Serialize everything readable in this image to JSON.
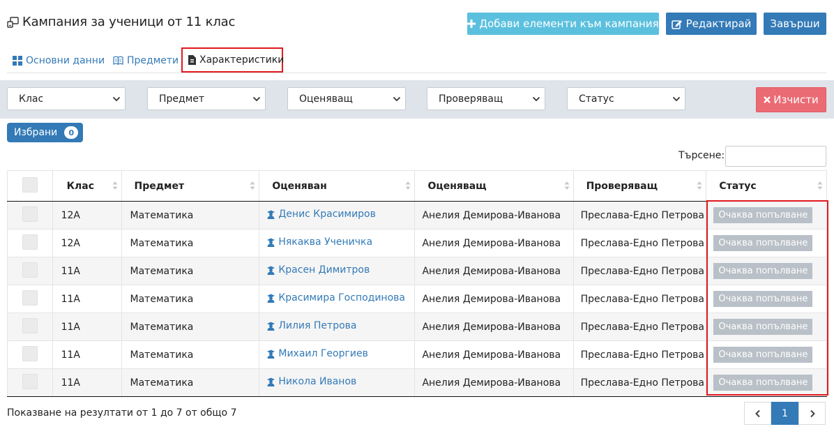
{
  "header": {
    "title": "Кампания за ученици от 11 клас",
    "add_items_label": "Добави елементи към кампания",
    "edit_label": "Редактирай",
    "finish_label": "Завърши"
  },
  "tabs": [
    {
      "label": "Основни данни",
      "icon": "grid-icon"
    },
    {
      "label": "Предмети",
      "icon": "book-icon"
    },
    {
      "label": "Характеристики",
      "icon": "document-icon"
    }
  ],
  "filters": {
    "class_selected": "Клас",
    "subject_selected": "Предмет",
    "evaluator_selected": "Оценяващ",
    "reviewer_selected": "Проверяващ",
    "status_selected": "Статус",
    "clear_label": "Изчисти"
  },
  "selected": {
    "label": "Избрани",
    "count": "0"
  },
  "search": {
    "label": "Търсене:",
    "value": ""
  },
  "table": {
    "headers": [
      "Клас",
      "Предмет",
      "Оценяван",
      "Оценяващ",
      "Проверяващ",
      "Статус"
    ],
    "rows": [
      {
        "class": "12А",
        "subject": "Математика",
        "student": "Денис Красимиров",
        "evaluator": "Анелия Демирова-Иванова",
        "reviewer": "Преслава-Едно Петрова",
        "status": "Очаква попълване"
      },
      {
        "class": "12А",
        "subject": "Математика",
        "student": "Някаква Ученичка",
        "evaluator": "Анелия Демирова-Иванова",
        "reviewer": "Преслава-Едно Петрова",
        "status": "Очаква попълване"
      },
      {
        "class": "11А",
        "subject": "Математика",
        "student": "Красен Димитров",
        "evaluator": "Анелия Демирова-Иванова",
        "reviewer": "Преслава-Едно Петрова",
        "status": "Очаква попълване"
      },
      {
        "class": "11А",
        "subject": "Математика",
        "student": "Красимира Господинова",
        "evaluator": "Анелия Демирова-Иванова",
        "reviewer": "Преслава-Едно Петрова",
        "status": "Очаква попълване"
      },
      {
        "class": "11А",
        "subject": "Математика",
        "student": "Лилия Петрова",
        "evaluator": "Анелия Демирова-Иванова",
        "reviewer": "Преслава-Едно Петрова",
        "status": "Очаква попълване"
      },
      {
        "class": "11А",
        "subject": "Математика",
        "student": "Михаил Георгиев",
        "evaluator": "Анелия Демирова-Иванова",
        "reviewer": "Преслава-Едно Петрова",
        "status": "Очаква попълване"
      },
      {
        "class": "11А",
        "subject": "Математика",
        "student": "Никола Иванов",
        "evaluator": "Анелия Демирова-Иванова",
        "reviewer": "Преслава-Едно Петрова",
        "status": "Очаква попълване"
      }
    ]
  },
  "footer": {
    "summary": "Показване на резултати от 1 до 7 от общо 7",
    "current_page": "1"
  },
  "colors": {
    "primary": "#337ab7",
    "info": "#5bc0de",
    "danger": "#ea6b73",
    "status_gray": "#b9c0c7",
    "highlight": "#e0191f"
  }
}
